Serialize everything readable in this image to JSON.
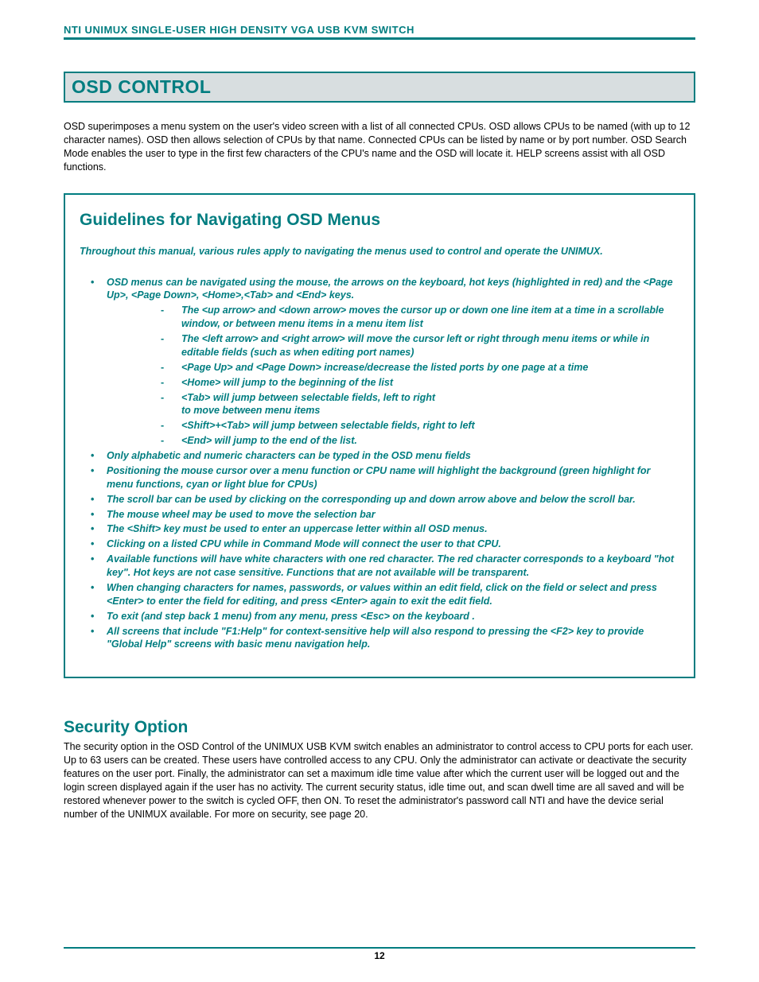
{
  "header": "NTI UNIMUX SINGLE-USER HIGH DENSITY VGA USB KVM SWITCH",
  "section_title": "OSD CONTROL",
  "intro": "OSD superimposes a menu system on the user's video screen with a list of all connected CPUs. OSD allows CPUs to be named (with up to 12 character names).   OSD then allows selection of CPUs by that name. Connected CPUs can be listed by name or by port number.  OSD Search Mode enables the user to type in the first few characters of the CPU's name and the OSD will locate it.  HELP screens assist with all OSD functions.",
  "guidelines": {
    "title": "Guidelines for Navigating OSD Menus",
    "subtitle": "Throughout this manual, various rules apply to navigating the menus used to control and operate the UNIMUX.",
    "b1": "OSD menus can be navigated using the mouse, the arrows on the keyboard, hot keys (highlighted in red) and the <Page Up>, <Page Down>, <Home>,<Tab>  and <End> keys.",
    "d1": "The <up arrow> and <down arrow> moves the cursor up or down one line item at a time in a scrollable window, or between menu items in a menu item list",
    "d2": "The <left arrow> and <right arrow> will move the cursor left or right through menu items or while in editable fields (such as when editing port names)",
    "d3": "<Page Up> and <Page Down> increase/decrease the listed ports by one page at a time",
    "d4": "<Home>  will jump to the beginning of the list",
    "d5": "<Tab> will jump between selectable fields, left to right",
    "d5b": "to move between menu items",
    "d6": "<Shift>+<Tab> will jump between selectable fields, right to left",
    "d7": "<End> will jump to the end of the list.",
    "b2": "Only alphabetic and numeric characters can be typed in the OSD menu fields",
    "b3": "Positioning the mouse cursor over a menu function or CPU name will highlight the background (green highlight for menu functions, cyan or light blue for CPUs)",
    "b4": "The scroll bar can be used by clicking on the corresponding up and down arrow above and below the scroll bar.",
    "b5": "The mouse wheel may be used to move the selection bar",
    "b6": "The <Shift> key must be used to enter an uppercase letter within all OSD menus.",
    "b7": "Clicking on a listed CPU while in Command Mode will connect the user to that CPU.",
    "b8": "Available functions will have white characters with one red character. The red character corresponds to a keyboard \"hot key\".   Hot keys are not case sensitive.    Functions that are not available will be transparent.",
    "b9": "When changing characters for names, passwords, or values within an edit field, click on the field or select and press <Enter> to enter the field for editing, and press <Enter> again to exit the edit field.",
    "b10": "To exit (and step back 1 menu) from any menu, press <Esc>  on the keyboard .",
    "b11": "All screens that include \"F1:Help\" for context-sensitive help will also respond to pressing the <F2> key to provide \"Global Help\" screens with basic menu navigation help."
  },
  "security": {
    "title": "Security Option",
    "body": "The security option in the OSD Control of the UNIMUX USB KVM switch enables an administrator to control access to CPU ports for each user.   Up to 63 users can be created.   These users have controlled access to any CPU.     Only the administrator can activate or deactivate the security features on the user port.  Finally, the administrator can set a maximum idle time value after which the current user will be logged out and the login screen displayed again if the user has no activity.  The current security status, idle time out, and scan dwell time are all saved and will be restored whenever power to the switch is cycled OFF, then ON.  To reset the administrator's password call NTI and have the device serial number of the UNIMUX available.   For more on security,    see page 20."
  },
  "page_number": "12"
}
